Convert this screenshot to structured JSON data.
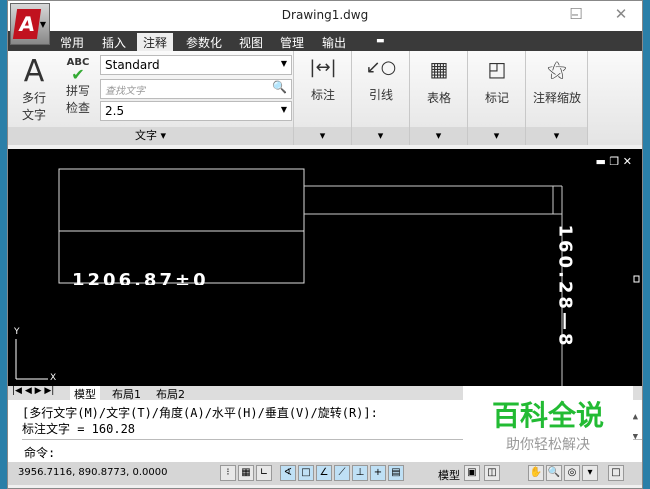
{
  "window": {
    "title": "Drawing1.dwg",
    "app_letter": "A"
  },
  "tabs": [
    "常用",
    "插入",
    "注释",
    "参数化",
    "视图",
    "管理",
    "输出"
  ],
  "active_tab": "注释",
  "ribbon": {
    "mtext": {
      "big": "A",
      "label1": "多行",
      "label2": "文字"
    },
    "spell": {
      "abc": "ABC",
      "label1": "拼写",
      "label2": "检查"
    },
    "style_value": "Standard",
    "find_placeholder": "查找文字",
    "height_value": "2.5",
    "text_panel_title": "文字",
    "panels": [
      "标注",
      "引线",
      "表格",
      "标记",
      "注释缩放"
    ]
  },
  "drawing": {
    "text_horizontal": "1206.87±0",
    "text_vertical": "160.28—8",
    "ucs_x": "X",
    "ucs_y": "Y"
  },
  "layout_tabs": [
    "模型",
    "布局1",
    "布局2"
  ],
  "command": {
    "line1": "[多行文字(M)/文字(T)/角度(A)/水平(H)/垂直(V)/旋转(R)]:",
    "line2": "标注文字 = 160.28",
    "prompt": "命令:"
  },
  "status": {
    "coords": "3956.7116, 890.8773, 0.0000",
    "model": "模型"
  },
  "watermark": {
    "title": "百科全说",
    "subtitle": "助你轻松解决",
    "color": "#22bb33"
  }
}
